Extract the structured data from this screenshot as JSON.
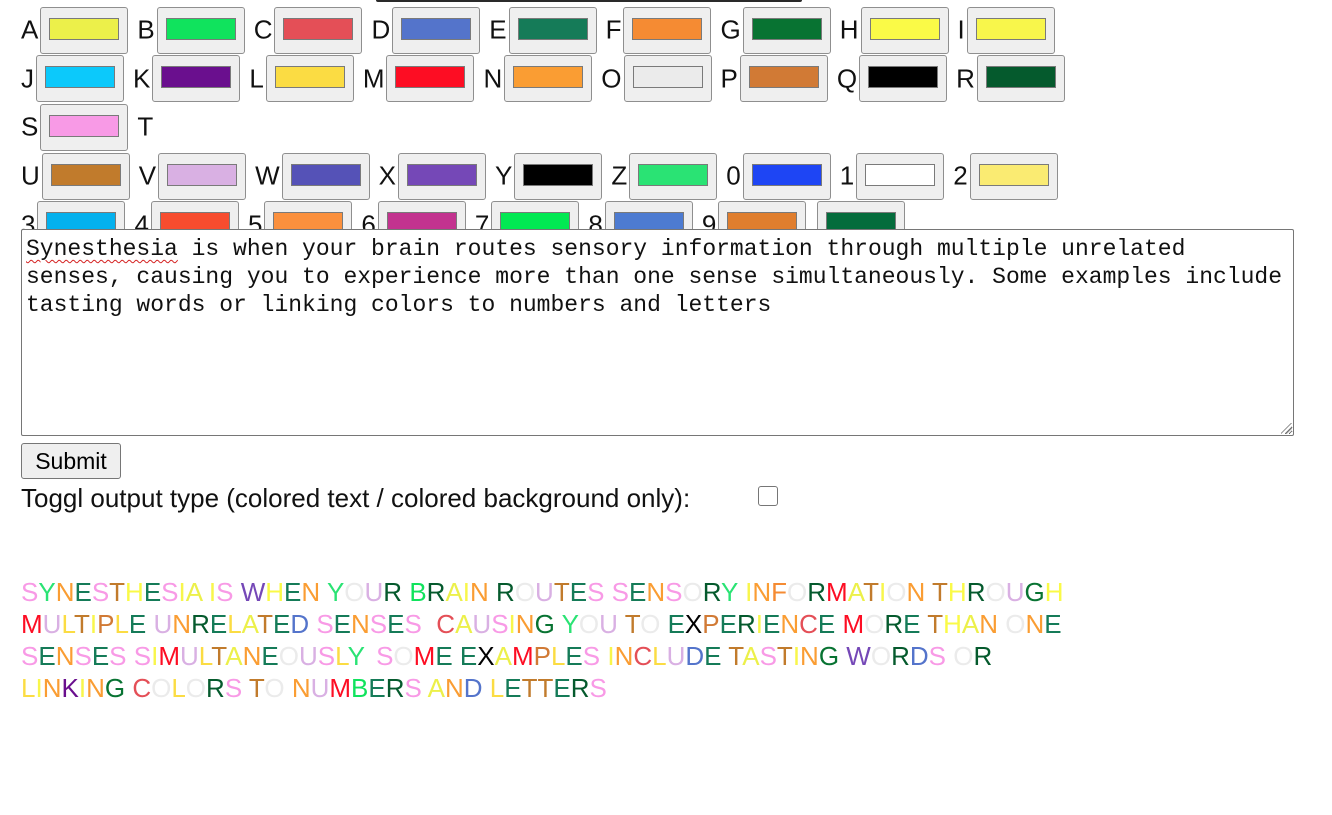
{
  "color_pickers": [
    {
      "label": "A",
      "color": "#ecf04a"
    },
    {
      "label": "B",
      "color": "#10e35d"
    },
    {
      "label": "C",
      "color": "#e44f57"
    },
    {
      "label": "D",
      "color": "#5474cb"
    },
    {
      "label": "E",
      "color": "#157b58"
    },
    {
      "label": "F",
      "color": "#f58b33"
    },
    {
      "label": "G",
      "color": "#087332"
    },
    {
      "label": "H",
      "color": "#fafa47"
    },
    {
      "label": "I",
      "color": "#f8f64b"
    },
    {
      "label": "J",
      "color": "#0cc9fb"
    },
    {
      "label": "K",
      "color": "#6a0f8e"
    },
    {
      "label": "L",
      "color": "#fbdc43"
    },
    {
      "label": "M",
      "color": "#fd0d23"
    },
    {
      "label": "N",
      "color": "#fa9d33"
    },
    {
      "label": "O",
      "color": "#ebebeb"
    },
    {
      "label": "P",
      "color": "#d17a35"
    },
    {
      "label": "Q",
      "color": "#000000"
    },
    {
      "label": "R",
      "color": "#055a2d"
    },
    {
      "label": "S",
      "color": "#f89ae6"
    },
    {
      "label": "T",
      "color": "#c17b2c"
    },
    {
      "label": "U",
      "color": "#d9b0e3"
    },
    {
      "label": "V",
      "color": "#5552b7"
    },
    {
      "label": "W",
      "color": "#7548b7"
    },
    {
      "label": "X",
      "color": "#000000"
    },
    {
      "label": "Y",
      "color": "#2ae374"
    },
    {
      "label": "Z",
      "color": "#1e45f4"
    },
    {
      "label": "0",
      "color": "#ffffff"
    },
    {
      "label": "1",
      "color": "#faeb72"
    },
    {
      "label": "2",
      "color": "#04b1ee"
    },
    {
      "label": "3",
      "color": "#f74c2e"
    },
    {
      "label": "4",
      "color": "#fb903d"
    },
    {
      "label": "5",
      "color": "#c3338f"
    },
    {
      "label": "6",
      "color": "#02e953"
    },
    {
      "label": "7",
      "color": "#4d7bd1"
    },
    {
      "label": "8",
      "color": "#e07e2e"
    },
    {
      "label": "9",
      "color": "#046c3c"
    }
  ],
  "textarea": {
    "value_first_word": "Synesthesia",
    "value_rest": " is when your brain routes sensory information through multiple unrelated senses, causing you to experience more than one sense simultaneously. Some examples include tasting words or linking colors to numbers and letters"
  },
  "submit_label": "Submit",
  "toggle_label": "Toggl output type (colored text / colored background only):",
  "toggle_checked": false,
  "output_lines": [
    "SYNESTHESIA IS WHEN YOUR BRAIN ROUTES SENSORY INFORMATION THROUGH",
    "MULTIPLE UNRELATED SENSES, CAUSING YOU TO EXPERIENCE MORE THAN ONE",
    "SENSES SIMULTANEOUSLY. SOME EXAMPLES INCLUDE TASTING WORDS OR",
    "LINKING COLORS TO NUMBERS AND LETTERS"
  ]
}
